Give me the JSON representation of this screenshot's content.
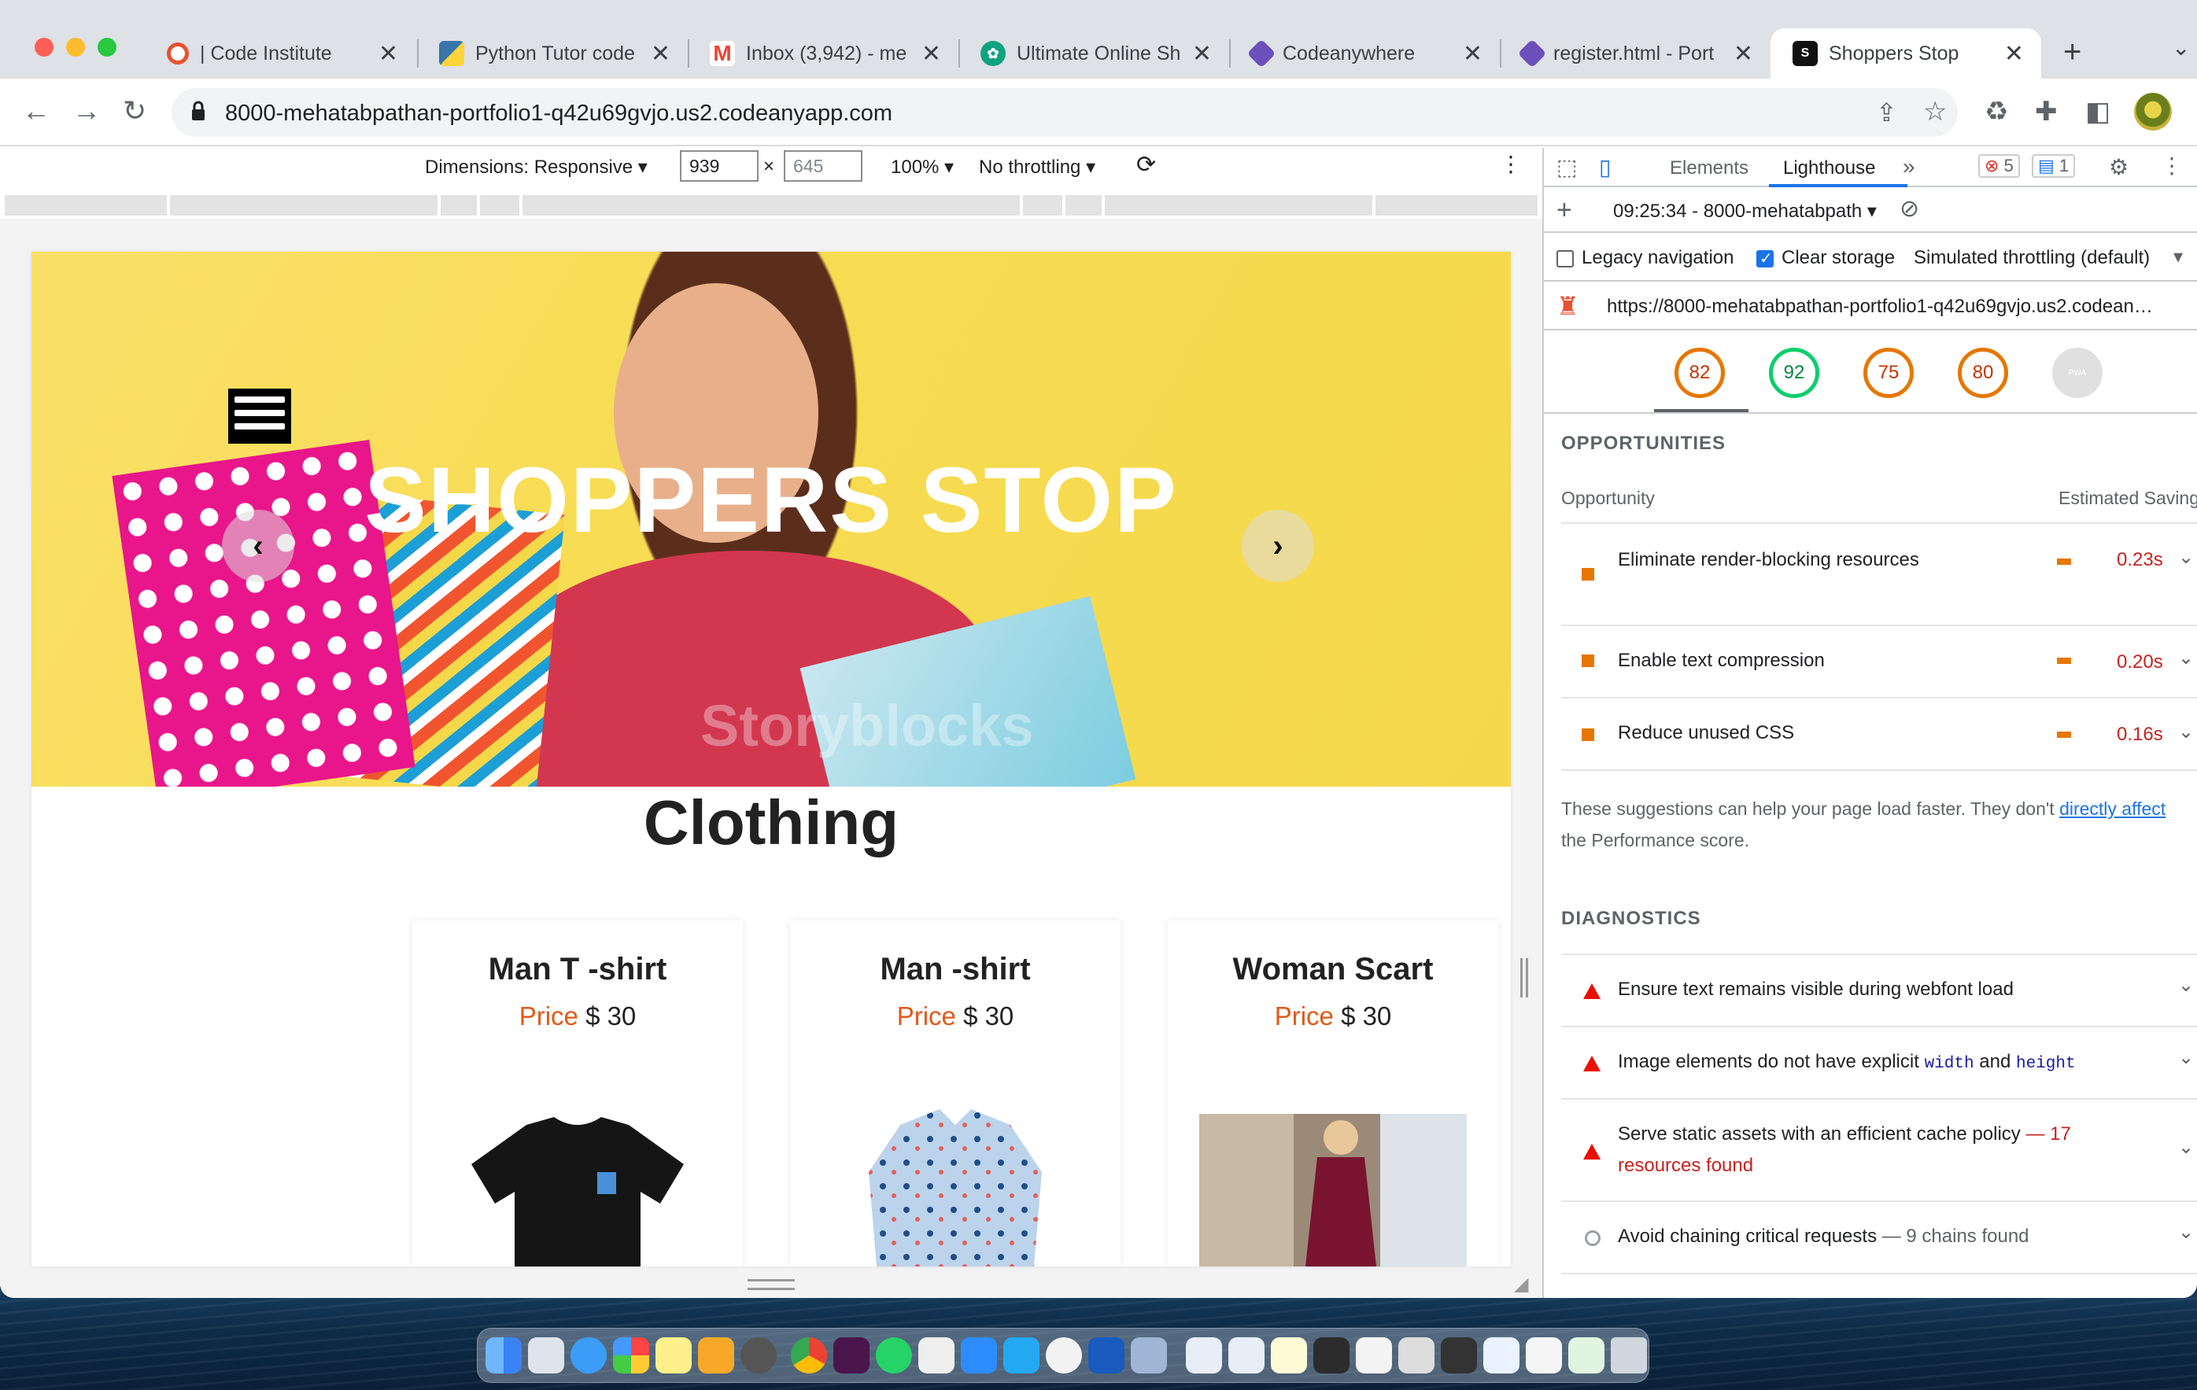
{
  "browser": {
    "tabs": [
      {
        "label": "| Code Institute",
        "icon": "code-institute-icon",
        "color": "#e8522f"
      },
      {
        "label": "Python Tutor code",
        "icon": "python-icon",
        "color": "#3776ab"
      },
      {
        "label": "Inbox (3,942) - me",
        "icon": "gmail-icon",
        "color": "#ea4335"
      },
      {
        "label": "Ultimate Online Sh",
        "icon": "openai-icon",
        "color": "#10a37f"
      },
      {
        "label": "Codeanywhere",
        "icon": "codeanywhere-icon",
        "color": "#6b4fbb"
      },
      {
        "label": "register.html - Port",
        "icon": "codeanywhere-icon",
        "color": "#6b4fbb"
      },
      {
        "label": "Shoppers Stop",
        "icon": "shoppers-stop-icon",
        "color": "#111111"
      }
    ],
    "close_glyph": "✕",
    "new_tab_glyph": "+",
    "url": "8000-mehatabpathan-portfolio1-q42u69gvjo.us2.codeanyapp.com"
  },
  "device_toolbar": {
    "dimensions_label": "Dimensions: Responsive",
    "width": "939",
    "height_placeholder": "645",
    "zoom": "100%",
    "throttling": "No throttling"
  },
  "site": {
    "hero_title": "SHOPPERS STOP",
    "watermark": "Storyblocks",
    "section_title": "Clothing",
    "price_label": "Price",
    "products": [
      {
        "name": "Man T -shirt",
        "price": "$ 30"
      },
      {
        "name": "Man -shirt",
        "price": "$ 30"
      },
      {
        "name": "Woman Scart",
        "price": "$ 30"
      }
    ]
  },
  "devtools": {
    "tabs": {
      "elements": "Elements",
      "lighthouse": "Lighthouse"
    },
    "error_count": "5",
    "info_count": "1",
    "report_select": "09:25:34 - 8000-mehatabpath",
    "legacy_navigation": "Legacy navigation",
    "clear_storage": "Clear storage",
    "throttling": "Simulated throttling (default)",
    "report_url": "https://8000-mehatabpathan-portfolio1-q42u69gvjo.us2.codean…",
    "scores": [
      {
        "value": "82",
        "color": "#e67700"
      },
      {
        "value": "92",
        "color": "#0cce6b"
      },
      {
        "value": "75",
        "color": "#e67700"
      },
      {
        "value": "80",
        "color": "#e67700"
      }
    ],
    "pwa_label": "PWA",
    "opportunities_heading": "OPPORTUNITIES",
    "opportunity_col": "Opportunity",
    "savings_col": "Estimated Savings",
    "opportunities": [
      {
        "label": "Eliminate render-blocking resources",
        "value": "0.23s"
      },
      {
        "label": "Enable text compression",
        "value": "0.20s"
      },
      {
        "label": "Reduce unused CSS",
        "value": "0.16s"
      }
    ],
    "suggestion_text_1": "These suggestions can help your page load faster. They don't",
    "suggestion_link": "directly affect",
    "suggestion_text_2": "the Performance score.",
    "diagnostics_heading": "DIAGNOSTICS",
    "diag_1": "Ensure text remains visible during webfont load",
    "diag_2_a": "Image elements do not have explicit",
    "diag_2_code1": "width",
    "diag_2_and": "and",
    "diag_2_code2": "height",
    "diag_3": "Serve static assets with an efficient cache policy",
    "diag_3_count": "— 17",
    "diag_3_found": "resources found",
    "diag_4": "Avoid chaining critical requests",
    "diag_4_extra": "— 9 chains found"
  }
}
